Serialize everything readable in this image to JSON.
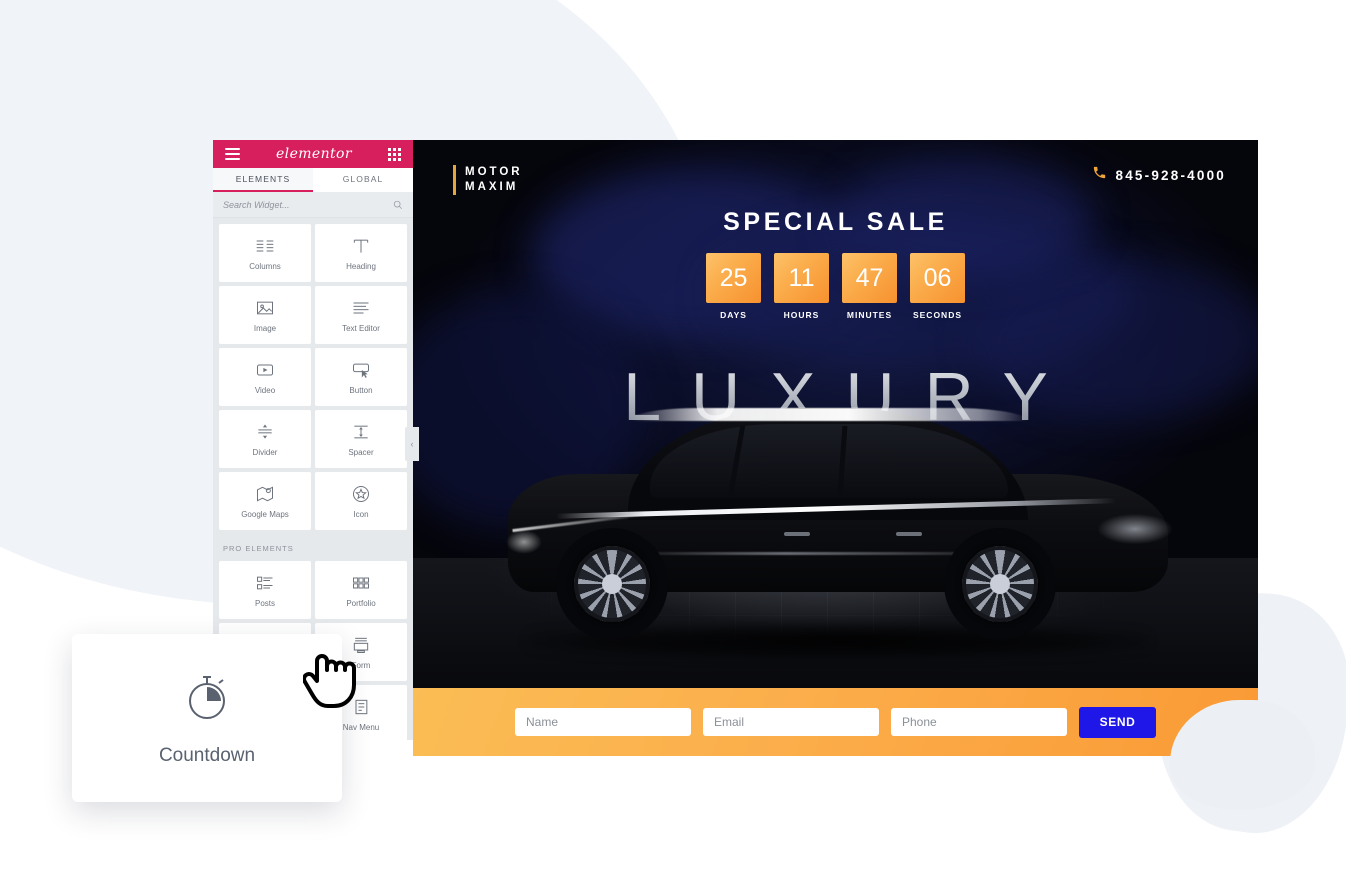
{
  "panel": {
    "brand": "elementor",
    "menu_icon": "hamburger-icon",
    "apps_icon": "grid-apps-icon",
    "tabs": [
      {
        "label": "ELEMENTS",
        "active": true
      },
      {
        "label": "GLOBAL",
        "active": false
      }
    ],
    "search": {
      "placeholder": "Search Widget...",
      "value": "",
      "icon": "search-icon"
    },
    "widgets": [
      {
        "label": "Columns",
        "icon": "columns-icon"
      },
      {
        "label": "Heading",
        "icon": "heading-icon"
      },
      {
        "label": "Image",
        "icon": "image-icon"
      },
      {
        "label": "Text Editor",
        "icon": "text-editor-icon"
      },
      {
        "label": "Video",
        "icon": "video-icon"
      },
      {
        "label": "Button",
        "icon": "button-icon"
      },
      {
        "label": "Divider",
        "icon": "divider-icon"
      },
      {
        "label": "Spacer",
        "icon": "spacer-icon"
      },
      {
        "label": "Google Maps",
        "icon": "google-maps-icon"
      },
      {
        "label": "Icon",
        "icon": "star-icon"
      }
    ],
    "pro_heading": "PRO ELEMENTS",
    "pro_widgets": [
      {
        "label": "Posts",
        "icon": "posts-icon"
      },
      {
        "label": "Portfolio",
        "icon": "portfolio-icon"
      },
      {
        "label": "",
        "icon": ""
      },
      {
        "label": "Form",
        "icon": "form-icon"
      },
      {
        "label": "",
        "icon": ""
      },
      {
        "label": "Nav Menu",
        "icon": "nav-menu-icon"
      }
    ],
    "collapse_icon": "chevron-left-icon"
  },
  "tooltip_card": {
    "label": "Countdown",
    "icon": "stopwatch-icon"
  },
  "site": {
    "logo": {
      "line1": "MOTOR",
      "line2": "MAXIM",
      "accent": "#e8a33d"
    },
    "phone": {
      "number": "845-928-4000",
      "icon": "phone-icon"
    },
    "sale_title": "SPECIAL SALE",
    "hero_word": "LUXURY",
    "countdown": [
      {
        "value": "25",
        "label": "DAYS"
      },
      {
        "value": "11",
        "label": "HOURS"
      },
      {
        "value": "47",
        "label": "MINUTES"
      },
      {
        "value": "06",
        "label": "SECONDS"
      }
    ],
    "form": {
      "name_placeholder": "Name",
      "name_value": "",
      "email_placeholder": "Email",
      "email_value": "",
      "phone_placeholder": "Phone",
      "phone_value": "",
      "send_label": "SEND",
      "send_color": "#1f16e8",
      "bar_color": "#fbae4b"
    }
  },
  "colors": {
    "elementor_pink": "#d61f5c",
    "accent_orange": "#f7912f",
    "panel_bg": "#e6e9ec",
    "site_bg": "#050507",
    "blob_gray": "#f0f3f7"
  }
}
